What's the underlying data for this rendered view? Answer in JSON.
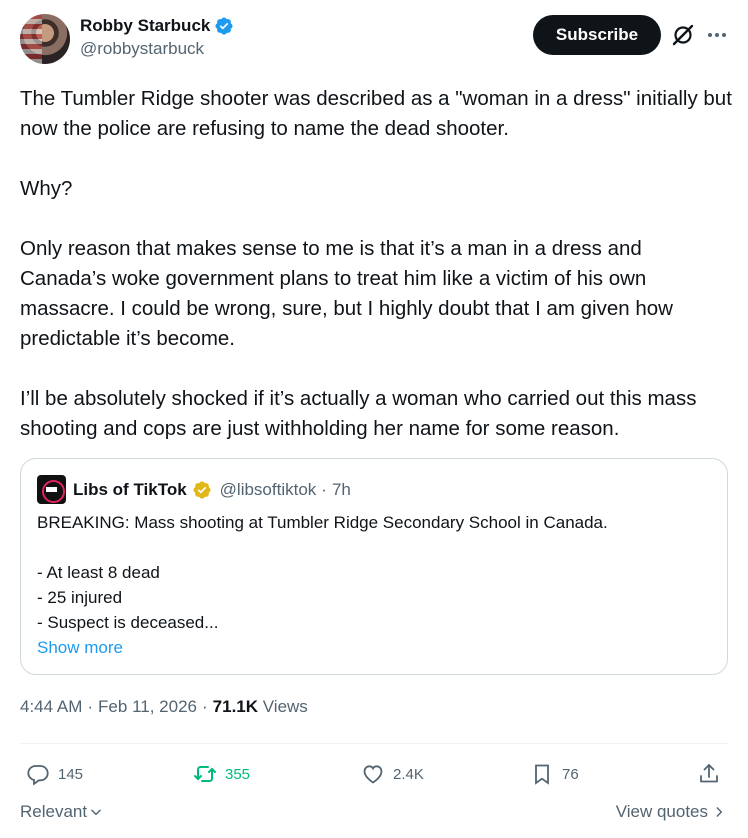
{
  "author": {
    "display_name": "Robby Starbuck",
    "handle": "@robbystarbuck"
  },
  "header": {
    "subscribe_label": "Subscribe",
    "grok_icon": "grok-icon",
    "more_icon": "more-dots-icon"
  },
  "tweet": {
    "paragraphs": [
      "The Tumbler Ridge shooter was described as a \"woman in a dress\" initially but now the police are refusing to name the dead shooter.",
      "Why?",
      "Only reason that makes sense to me is that it’s a man in a dress and Canada’s woke government plans to treat him like a victim of his own massacre. I could be wrong, sure, but I highly doubt that I am given how predictable it’s become.",
      "I’ll be absolutely shocked if it’s actually a woman who carried out this mass shooting and cops are just withholding her name for some reason."
    ]
  },
  "quote": {
    "display_name": "Libs of TikTok",
    "handle": "@libsoftiktok",
    "separator": "·",
    "age": "7h",
    "lines": [
      "BREAKING: Mass shooting at Tumbler Ridge Secondary School in Canada.",
      "- At least 8 dead",
      "- 25 injured",
      "- Suspect is deceased..."
    ],
    "show_more": "Show more"
  },
  "meta": {
    "time": "4:44 AM",
    "separator": "·",
    "date": "Feb 11, 2026",
    "views_count": "71.1K",
    "views_label": "Views"
  },
  "actions": {
    "replies": "145",
    "reposts": "355",
    "likes": "2.4K",
    "bookmarks": "76"
  },
  "footer": {
    "sort_label": "Relevant",
    "view_quotes_label": "View quotes"
  },
  "colors": {
    "verified_blue": "#1d9bf0",
    "gold_badge": "#e2b719",
    "repost_green": "#00ba7c",
    "text": "#0f1419",
    "muted": "#536471"
  }
}
